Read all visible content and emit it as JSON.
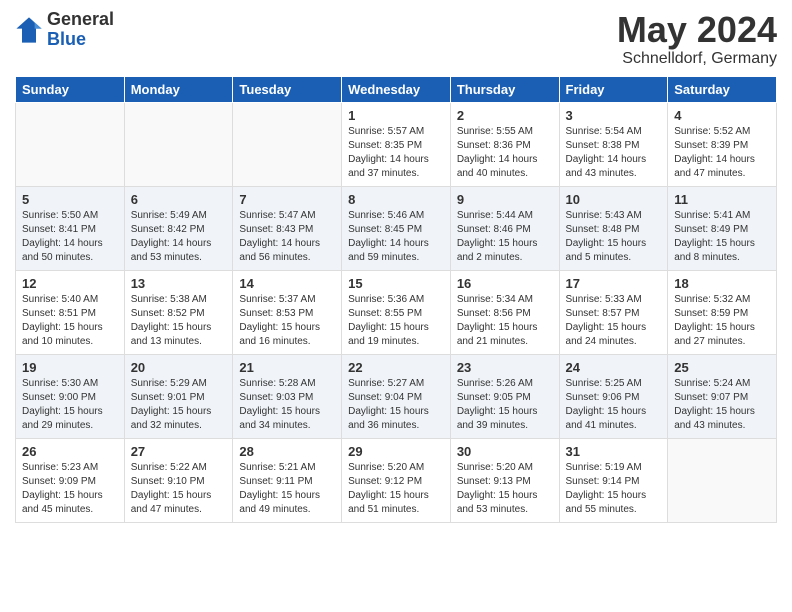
{
  "header": {
    "logo_general": "General",
    "logo_blue": "Blue",
    "month_title": "May 2024",
    "location": "Schnelldorf, Germany"
  },
  "weekdays": [
    "Sunday",
    "Monday",
    "Tuesday",
    "Wednesday",
    "Thursday",
    "Friday",
    "Saturday"
  ],
  "weeks": [
    [
      {
        "day": "",
        "text": ""
      },
      {
        "day": "",
        "text": ""
      },
      {
        "day": "",
        "text": ""
      },
      {
        "day": "1",
        "text": "Sunrise: 5:57 AM\nSunset: 8:35 PM\nDaylight: 14 hours\nand 37 minutes."
      },
      {
        "day": "2",
        "text": "Sunrise: 5:55 AM\nSunset: 8:36 PM\nDaylight: 14 hours\nand 40 minutes."
      },
      {
        "day": "3",
        "text": "Sunrise: 5:54 AM\nSunset: 8:38 PM\nDaylight: 14 hours\nand 43 minutes."
      },
      {
        "day": "4",
        "text": "Sunrise: 5:52 AM\nSunset: 8:39 PM\nDaylight: 14 hours\nand 47 minutes."
      }
    ],
    [
      {
        "day": "5",
        "text": "Sunrise: 5:50 AM\nSunset: 8:41 PM\nDaylight: 14 hours\nand 50 minutes."
      },
      {
        "day": "6",
        "text": "Sunrise: 5:49 AM\nSunset: 8:42 PM\nDaylight: 14 hours\nand 53 minutes."
      },
      {
        "day": "7",
        "text": "Sunrise: 5:47 AM\nSunset: 8:43 PM\nDaylight: 14 hours\nand 56 minutes."
      },
      {
        "day": "8",
        "text": "Sunrise: 5:46 AM\nSunset: 8:45 PM\nDaylight: 14 hours\nand 59 minutes."
      },
      {
        "day": "9",
        "text": "Sunrise: 5:44 AM\nSunset: 8:46 PM\nDaylight: 15 hours\nand 2 minutes."
      },
      {
        "day": "10",
        "text": "Sunrise: 5:43 AM\nSunset: 8:48 PM\nDaylight: 15 hours\nand 5 minutes."
      },
      {
        "day": "11",
        "text": "Sunrise: 5:41 AM\nSunset: 8:49 PM\nDaylight: 15 hours\nand 8 minutes."
      }
    ],
    [
      {
        "day": "12",
        "text": "Sunrise: 5:40 AM\nSunset: 8:51 PM\nDaylight: 15 hours\nand 10 minutes."
      },
      {
        "day": "13",
        "text": "Sunrise: 5:38 AM\nSunset: 8:52 PM\nDaylight: 15 hours\nand 13 minutes."
      },
      {
        "day": "14",
        "text": "Sunrise: 5:37 AM\nSunset: 8:53 PM\nDaylight: 15 hours\nand 16 minutes."
      },
      {
        "day": "15",
        "text": "Sunrise: 5:36 AM\nSunset: 8:55 PM\nDaylight: 15 hours\nand 19 minutes."
      },
      {
        "day": "16",
        "text": "Sunrise: 5:34 AM\nSunset: 8:56 PM\nDaylight: 15 hours\nand 21 minutes."
      },
      {
        "day": "17",
        "text": "Sunrise: 5:33 AM\nSunset: 8:57 PM\nDaylight: 15 hours\nand 24 minutes."
      },
      {
        "day": "18",
        "text": "Sunrise: 5:32 AM\nSunset: 8:59 PM\nDaylight: 15 hours\nand 27 minutes."
      }
    ],
    [
      {
        "day": "19",
        "text": "Sunrise: 5:30 AM\nSunset: 9:00 PM\nDaylight: 15 hours\nand 29 minutes."
      },
      {
        "day": "20",
        "text": "Sunrise: 5:29 AM\nSunset: 9:01 PM\nDaylight: 15 hours\nand 32 minutes."
      },
      {
        "day": "21",
        "text": "Sunrise: 5:28 AM\nSunset: 9:03 PM\nDaylight: 15 hours\nand 34 minutes."
      },
      {
        "day": "22",
        "text": "Sunrise: 5:27 AM\nSunset: 9:04 PM\nDaylight: 15 hours\nand 36 minutes."
      },
      {
        "day": "23",
        "text": "Sunrise: 5:26 AM\nSunset: 9:05 PM\nDaylight: 15 hours\nand 39 minutes."
      },
      {
        "day": "24",
        "text": "Sunrise: 5:25 AM\nSunset: 9:06 PM\nDaylight: 15 hours\nand 41 minutes."
      },
      {
        "day": "25",
        "text": "Sunrise: 5:24 AM\nSunset: 9:07 PM\nDaylight: 15 hours\nand 43 minutes."
      }
    ],
    [
      {
        "day": "26",
        "text": "Sunrise: 5:23 AM\nSunset: 9:09 PM\nDaylight: 15 hours\nand 45 minutes."
      },
      {
        "day": "27",
        "text": "Sunrise: 5:22 AM\nSunset: 9:10 PM\nDaylight: 15 hours\nand 47 minutes."
      },
      {
        "day": "28",
        "text": "Sunrise: 5:21 AM\nSunset: 9:11 PM\nDaylight: 15 hours\nand 49 minutes."
      },
      {
        "day": "29",
        "text": "Sunrise: 5:20 AM\nSunset: 9:12 PM\nDaylight: 15 hours\nand 51 minutes."
      },
      {
        "day": "30",
        "text": "Sunrise: 5:20 AM\nSunset: 9:13 PM\nDaylight: 15 hours\nand 53 minutes."
      },
      {
        "day": "31",
        "text": "Sunrise: 5:19 AM\nSunset: 9:14 PM\nDaylight: 15 hours\nand 55 minutes."
      },
      {
        "day": "",
        "text": ""
      }
    ]
  ]
}
